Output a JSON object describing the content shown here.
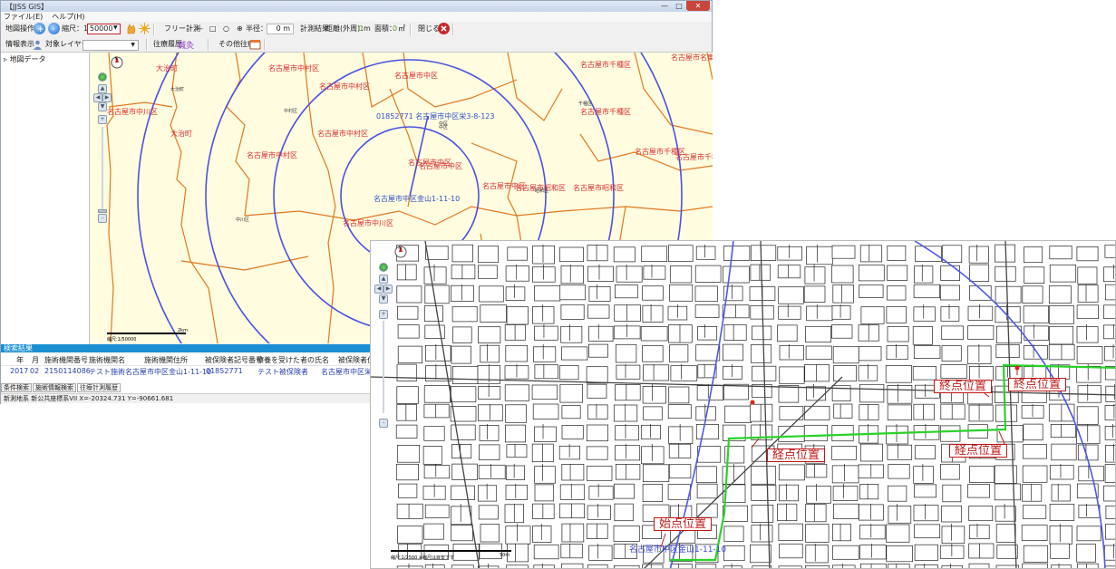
{
  "window": {
    "title": "【JJSS GIS】",
    "controls": [
      "—",
      "□",
      "✕"
    ]
  },
  "menu": {
    "file": "ファイル(E)",
    "help": "ヘルプ(H)"
  },
  "toolbar": {
    "map_ops_label": "地図操作",
    "scale_label": "縮尺：1 /",
    "scale_value": "50000",
    "free_measure_label": "フリー計測",
    "radius_label": "半径：",
    "radius_value": "0",
    "radius_unit": "m",
    "measure_result_label": "計測結果",
    "distance_label": "距離(外周)：",
    "distance_value": "0",
    "distance_unit": "m",
    "area_label": "面積：",
    "area_value": "0",
    "area_unit": "㎡",
    "close_label": "閉じる",
    "info_display_label": "情報表示",
    "target_layer_label": "対象レイヤー：",
    "target_layer_value": "",
    "visit_record_label": "往療履歴",
    "other_visit_label": "その他往療"
  },
  "tree": {
    "root": "地図データ"
  },
  "map1": {
    "wards": [
      "大治町",
      "名古屋市中村区",
      "名古屋市中村区",
      "名古屋市中区",
      "名古屋市千種区",
      "名古屋市名東",
      "名古屋市中川区",
      "大治町",
      "名古屋市中村区",
      "名古屋市中村区",
      "名古屋市中区",
      "名古屋市千種区",
      "名古屋市千種区",
      "名古屋市中区",
      "名古屋市昭和区",
      "名古屋市中区",
      "名古屋市中川区",
      "名古屋市千種",
      "名古屋市昭和区"
    ],
    "small_labels": [
      "大治町",
      "中村区",
      "中区",
      "千種区",
      "中区",
      "昭和区",
      "中川区"
    ],
    "patient_label": "01852771 名古屋市中区栄3-8-123",
    "origin_label": "名古屋市中区金山1-11-10",
    "scale_text": "縮尺:1/50000",
    "scale_unit": "2km"
  },
  "results": {
    "title": "検索結果",
    "headers": [
      "年",
      "月",
      "施術機関番号",
      "施術機関名",
      "施術機関住所",
      "被保険者記号番号",
      "療養を受けた者の氏名",
      "被保険者住"
    ],
    "rows": [
      [
        "2017",
        "02",
        "2150114086",
        "テスト施術",
        "名古屋市中区金山1-11-10",
        "01852771",
        "テスト被保険者",
        "名古屋市中区栄"
      ]
    ]
  },
  "tabs": [
    "条件検索",
    "施術情報検索",
    "往療計測履歴"
  ],
  "status": "新測地系 新公共座標系VII  X=-20324.731 Y=-90661.681",
  "map2": {
    "labels": [
      {
        "key": "start",
        "text": "始点位置"
      },
      {
        "key": "mid1",
        "text": "経点位置"
      },
      {
        "key": "mid2",
        "text": "経点位置"
      },
      {
        "key": "end1",
        "text": "終点位置"
      },
      {
        "key": "end2",
        "text": "終点位置"
      }
    ],
    "origin_label": "名古屋市中区金山1-11-10",
    "scale_text": "縮尺:1/2500  ※縮尺は目安です",
    "scale_unit": "50m"
  },
  "colors": {
    "accent": "#1a8fd1",
    "ward_label": "#d63030",
    "boundary": "#e0791e",
    "circle": "#4a52e0",
    "route": "#2bd12b",
    "map1_bg": "#fffce0"
  }
}
